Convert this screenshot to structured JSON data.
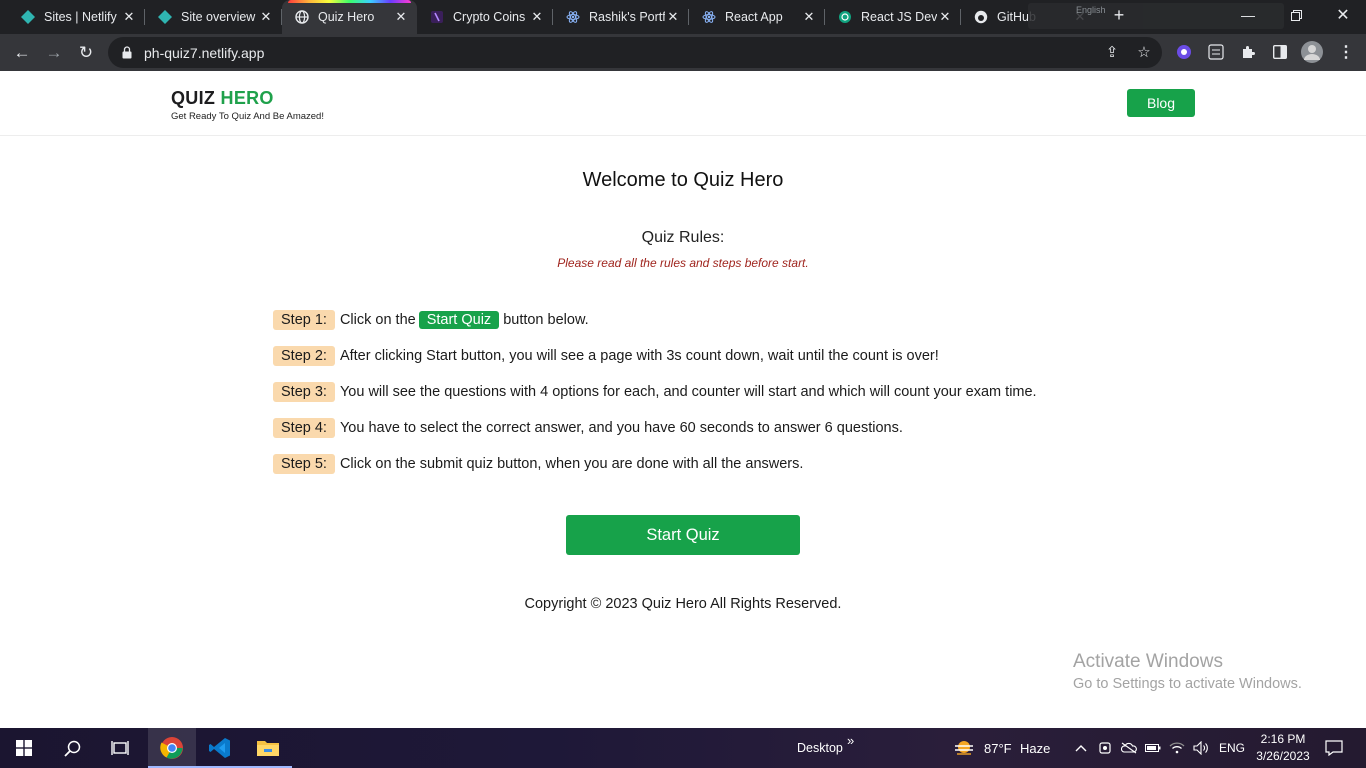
{
  "browser": {
    "tabs": [
      {
        "title": "Sites | Netlify",
        "icon": "netlify-icon"
      },
      {
        "title": "Site overview",
        "icon": "netlify-icon"
      },
      {
        "title": "Quiz Hero",
        "icon": "globe-icon",
        "active": true
      },
      {
        "title": "Crypto Coins",
        "icon": "crypto-icon"
      },
      {
        "title": "Rashik's Portf",
        "icon": "react-icon"
      },
      {
        "title": "React App",
        "icon": "react-icon"
      },
      {
        "title": "React JS Deve",
        "icon": "chatgpt-icon"
      },
      {
        "title": "GitHub",
        "icon": "github-icon"
      }
    ],
    "overlay_text": "English",
    "url": "ph-quiz7.netlify.app"
  },
  "site": {
    "brand_quiz": "QUIZ",
    "brand_hero": "HERO",
    "tagline": "Get Ready To Quiz And Be Amazed!",
    "blog_label": "Blog",
    "welcome": "Welcome to Quiz Hero",
    "rules_title": "Quiz Rules:",
    "rules_note": "Please read all the rules and steps before start.",
    "steps": [
      {
        "label": "Step 1:",
        "pre": "Click on the",
        "button": "Start Quiz",
        "post": "button below."
      },
      {
        "label": "Step 2:",
        "text": "After clicking Start button, you will see a page with 3s count down, wait until the count is over!"
      },
      {
        "label": "Step 3:",
        "text": "You will see the questions with 4 options for each, and counter will start and which will count your exam time."
      },
      {
        "label": "Step 4:",
        "text": "You have to select the correct answer, and you have 60 seconds to answer 6 questions."
      },
      {
        "label": "Step 5:",
        "text": "Click on the submit quiz button, when you are done with all the answers."
      }
    ],
    "start_button": "Start Quiz",
    "copyright": "Copyright © 2023 Quiz Hero All Rights Reserved."
  },
  "watermark": {
    "line1": "Activate Windows",
    "line2": "Go to Settings to activate Windows."
  },
  "taskbar": {
    "desktop_label": "Desktop",
    "desktop_chevron": "»",
    "weather_temp": "87°F",
    "weather_desc": "Haze",
    "language": "ENG",
    "time": "2:16 PM",
    "date": "3/26/2023"
  },
  "colors": {
    "accent_green": "#17a24a",
    "step_badge": "#fad9ad",
    "note_red": "#a0261f"
  }
}
